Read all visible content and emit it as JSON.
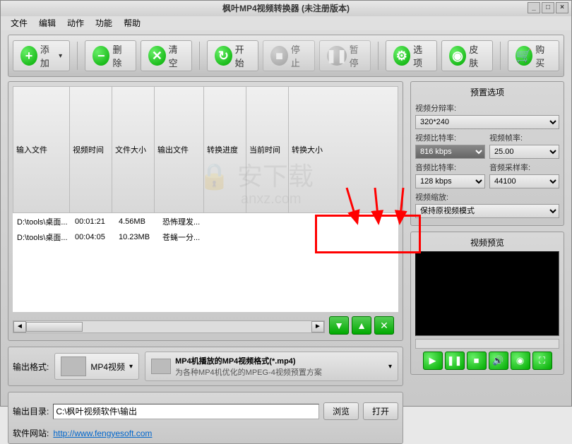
{
  "title": "枫叶MP4视频转换器   (未注册版本)",
  "menu": [
    "文件",
    "编辑",
    "动作",
    "功能",
    "帮助"
  ],
  "toolbar": {
    "add": "添加",
    "del": "删除",
    "clear": "清空",
    "start": "开始",
    "stop": "停止",
    "pause": "暂停",
    "options": "选项",
    "skin": "皮肤",
    "buy": "购买"
  },
  "table": {
    "headers": [
      "输入文件",
      "视频时间",
      "文件大小",
      "输出文件",
      "转换进度",
      "当前时间",
      "转换大小"
    ],
    "rows": [
      {
        "in": "D:\\tools\\桌面...",
        "time": "00:01:21",
        "size": "4.56MB",
        "out": "恐怖理发...",
        "prog": "",
        "cur": "",
        "outsize": ""
      },
      {
        "in": "D:\\tools\\桌面...",
        "time": "00:04:05",
        "size": "10.23MB",
        "out": "苍蝇一分...",
        "prog": "",
        "cur": "",
        "outsize": ""
      }
    ]
  },
  "preset": {
    "title": "预置选项",
    "res_label": "视频分辩率:",
    "res": "320*240",
    "vbr_label": "视频比特率:",
    "vbr": "816 kbps",
    "fps_label": "视频帧率:",
    "fps": "25.00",
    "abr_label": "音频比特率:",
    "abr": "128 kbps",
    "asr_label": "音频采样率:",
    "asr": "44100",
    "zoom_label": "视频缩放:",
    "zoom": "保持原视频模式"
  },
  "preview": {
    "title": "视频预览"
  },
  "format": {
    "label": "输出格式:",
    "name": "MP4视频",
    "desc_title": "MP4机播放的MP4视频格式(*.mp4)",
    "desc_sub": "为各种MP4机优化的MPEG-4视频预置方案"
  },
  "outdir": {
    "label": "输出目录:",
    "path": "C:\\枫叶视频软件\\输出",
    "browse": "浏览",
    "open": "打开"
  },
  "site": {
    "label": "软件网站:",
    "url": "http://www.fengyesoft.com"
  },
  "watermark": {
    "big": "安下载",
    "small": "anxz.com"
  }
}
